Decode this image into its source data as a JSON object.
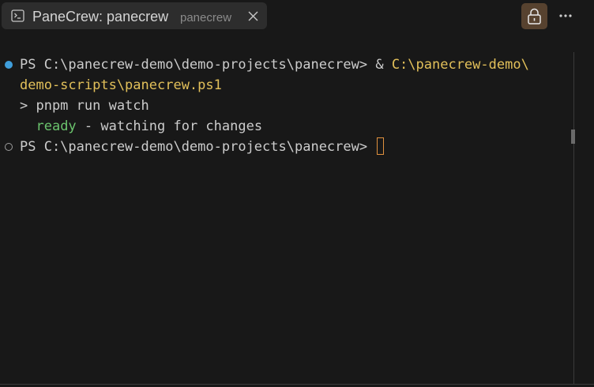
{
  "tab": {
    "icon": "terminal-icon",
    "title": "PaneCrew: panecrew",
    "description": "panecrew",
    "close_icon": "close-icon"
  },
  "toolbar": {
    "lock_icon": "lock-icon",
    "more_icon": "more-horizontal-icon"
  },
  "terminal": {
    "line1_prompt": "PS C:\\panecrew-demo\\demo-projects\\panecrew> & ",
    "line1_path": "C:\\panecrew-demo\\",
    "line2_path": "demo-scripts\\panecrew.ps1",
    "line3": "> pnpm run watch",
    "line4_indent": "  ",
    "line4_ready": "ready",
    "line4_rest": " - watching for changes",
    "line5_prompt": "PS C:\\panecrew-demo\\demo-projects\\panecrew> "
  },
  "colors": {
    "background": "#181818",
    "tab_background": "#2d2d2d",
    "path_yellow": "#e2c05a",
    "ready_green": "#6bc46d",
    "success_dot": "#3f9edb",
    "cursor": "#e0913e",
    "lock_background": "#57422f"
  }
}
